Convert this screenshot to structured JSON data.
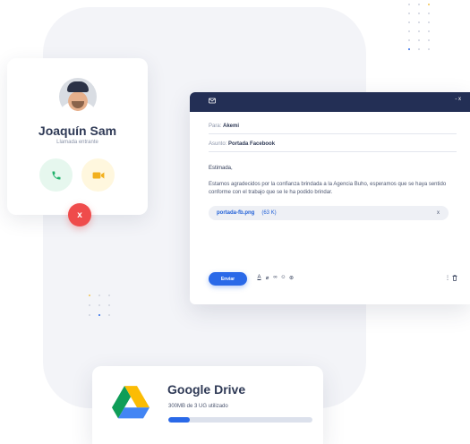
{
  "call": {
    "name": "Joaquín Sam",
    "status": "Llamada entrante",
    "accept_icon": "phone-icon",
    "video_icon": "video-camera-icon",
    "hangup_label": "x",
    "colors": {
      "accept": "#21b26b",
      "video": "#f2b01e",
      "hangup": "#ef4b4b"
    }
  },
  "email": {
    "header_icon": "mail-icon",
    "close_label": "- x",
    "to_label": "Para:",
    "to_value": "Akemi",
    "subject_label": "Asunto:",
    "subject_value": "Portada Facebook",
    "greeting": "Estimada,",
    "body": "Estamos agradecidos por la confianza brindada a la Agencia Buho, esperamos que se haya sentido conforme con el trabajo que se le ha podido brindar.",
    "attachment": {
      "name": "portada-fb.png",
      "size": "(63 K)",
      "remove": "x"
    },
    "send_label": "Enviar",
    "toolbar_icons": [
      "text-format-icon",
      "attach-icon",
      "link-icon",
      "emoji-icon",
      "drive-icon"
    ],
    "toolbar_glyphs": [
      "A",
      "⌀",
      "∞",
      "☺",
      "⊛"
    ],
    "more_glyph": "⋮",
    "delete_glyph": "🗑"
  },
  "drive": {
    "title": "Google Drive",
    "usage": "300MB de 3 UG utilizado",
    "progress_fraction": 0.15,
    "colors": {
      "accent": "#2a69e8",
      "track": "#dce1ec"
    }
  }
}
